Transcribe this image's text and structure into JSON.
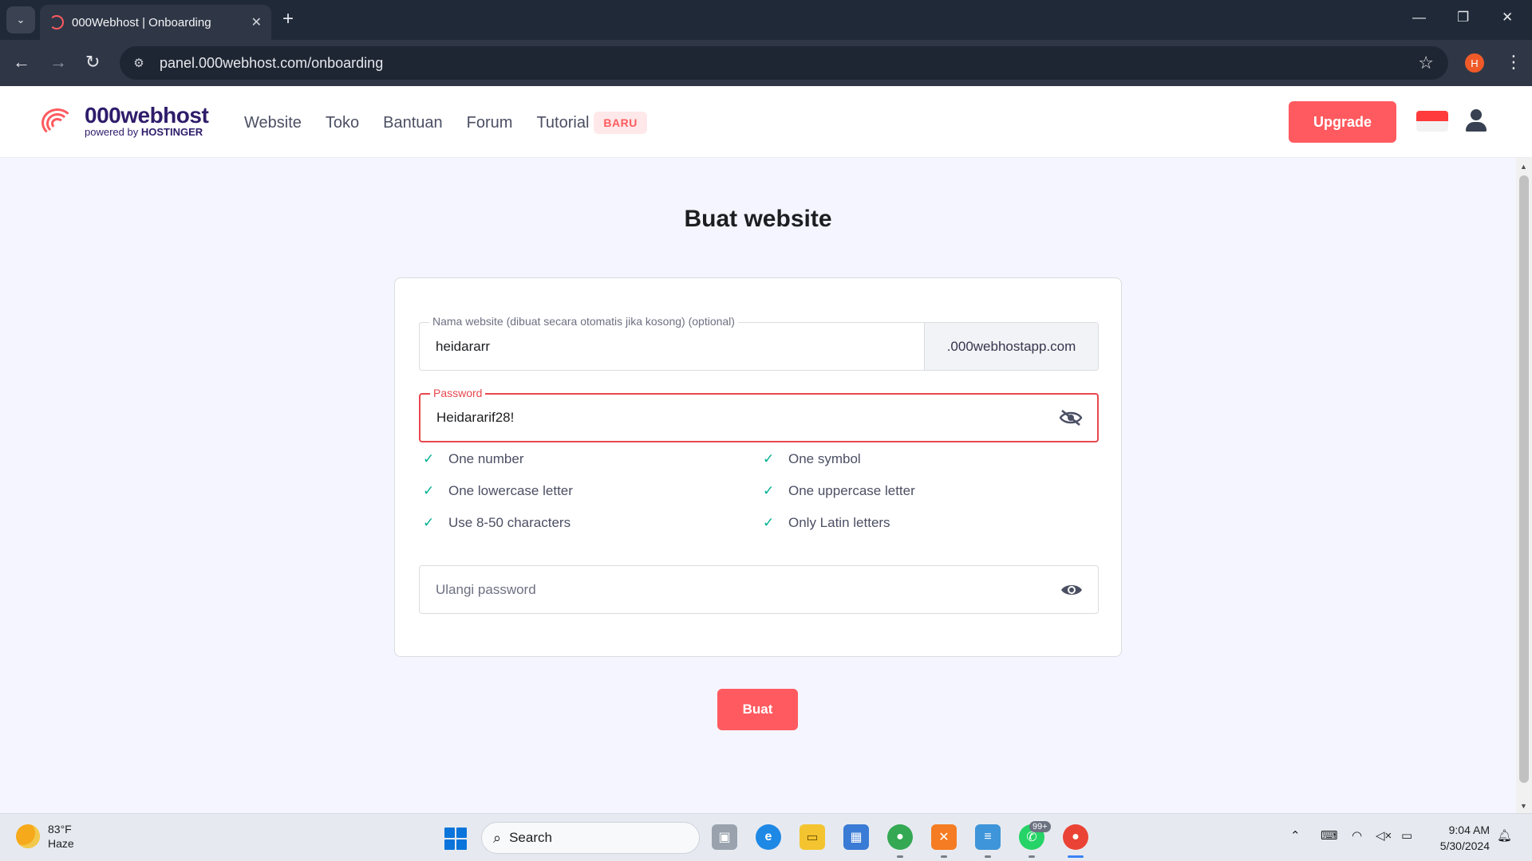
{
  "browser": {
    "tab_title": "000Webhost | Onboarding",
    "url": "panel.000webhost.com/onboarding",
    "profile_initial": "H"
  },
  "header": {
    "logo_brand": "000webhost",
    "logo_powered_prefix": "powered by",
    "logo_powered_brand": "HOSTINGER",
    "nav": [
      "Website",
      "Toko",
      "Bantuan",
      "Forum",
      "Tutorial"
    ],
    "nav_badge": "BARU",
    "upgrade_label": "Upgrade"
  },
  "page": {
    "title": "Buat website",
    "website_name_label": "Nama website (dibuat secara otomatis jika kosong) (optional)",
    "website_name_value": "heidararr",
    "website_suffix": ".000webhostapp.com",
    "password_label": "Password",
    "password_value": "Heidararif28!",
    "rules": [
      "One number",
      "One symbol",
      "One lowercase letter",
      "One uppercase letter",
      "Use 8-50 characters",
      "Only Latin letters"
    ],
    "repeat_password_placeholder": "Ulangi password",
    "submit_label": "Buat"
  },
  "taskbar": {
    "weather_temp": "83°F",
    "weather_desc": "Haze",
    "search_label": "Search",
    "whatsapp_badge": "99+",
    "time": "9:04 AM",
    "date": "5/30/2024"
  },
  "colors": {
    "accent": "#ff5a5f",
    "error": "#e8484e",
    "success": "#00b090"
  }
}
